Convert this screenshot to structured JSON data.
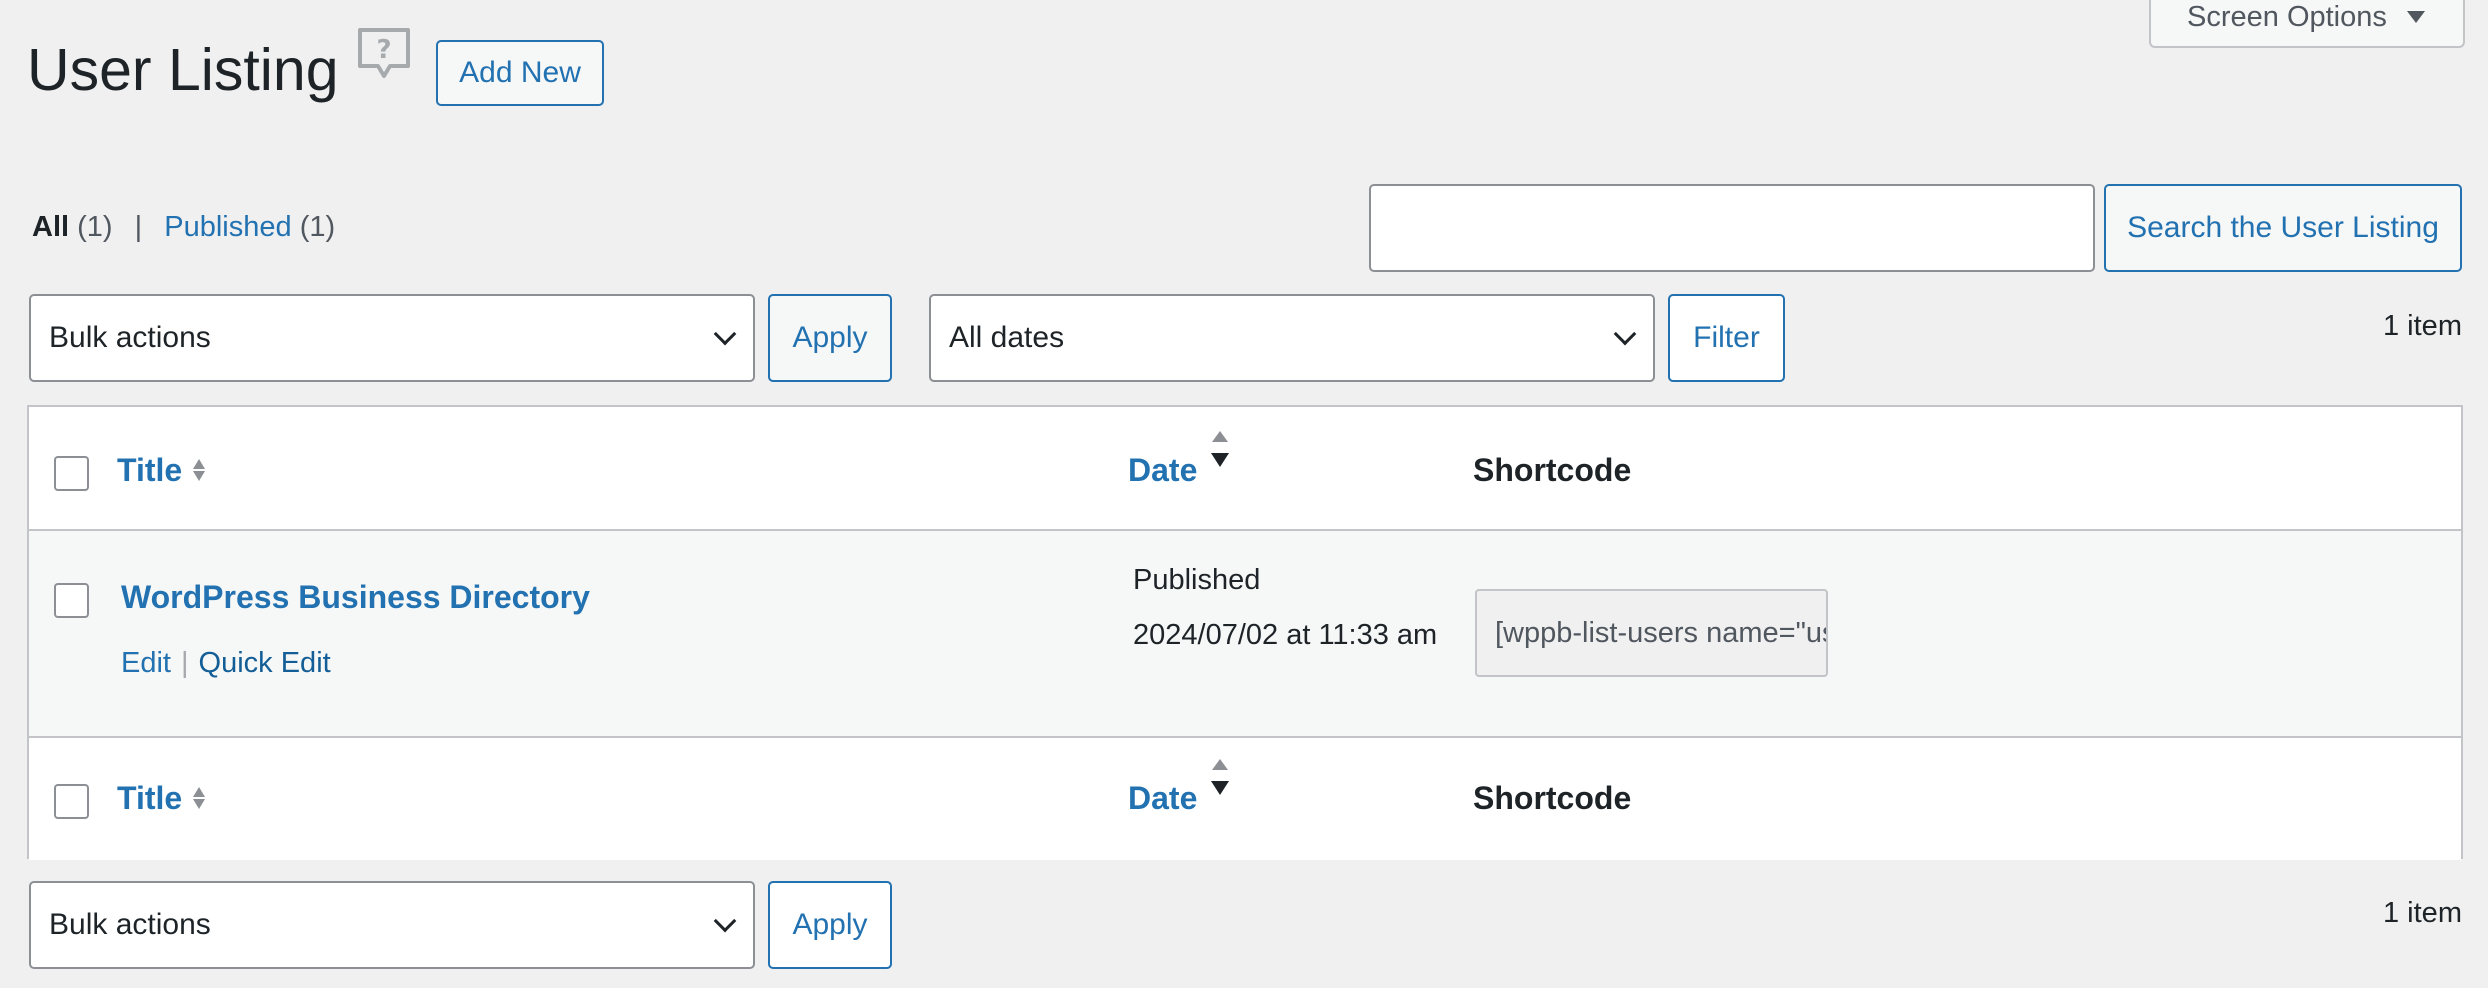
{
  "header": {
    "title": "User Listing",
    "add_new_label": "Add New",
    "screen_options_label": "Screen Options"
  },
  "views": {
    "all_label": "All",
    "all_count": "(1)",
    "separator": "|",
    "published_label": "Published",
    "published_count": "(1)"
  },
  "search": {
    "value": "",
    "button_label": "Search the User Listing"
  },
  "top_nav": {
    "bulk_selected": "Bulk actions",
    "apply_label": "Apply",
    "dates_selected": "All dates",
    "filter_label": "Filter",
    "item_count": "1 item"
  },
  "table": {
    "columns": {
      "title": "Title",
      "date": "Date",
      "shortcode": "Shortcode"
    },
    "rows": [
      {
        "title": "WordPress Business Directory",
        "actions": {
          "edit": "Edit",
          "separator": "|",
          "quick_edit": "Quick Edit"
        },
        "date_status": "Published",
        "date_value": "2024/07/02 at 11:33 am",
        "shortcode": "[wppb-list-users name=\"userlisting\"]"
      }
    ]
  },
  "bottom_nav": {
    "bulk_selected": "Bulk actions",
    "apply_label": "Apply",
    "item_count": "1 item"
  },
  "colors": {
    "link": "#2271b1",
    "background": "#f0f0f1",
    "border": "#c3c4c7"
  }
}
